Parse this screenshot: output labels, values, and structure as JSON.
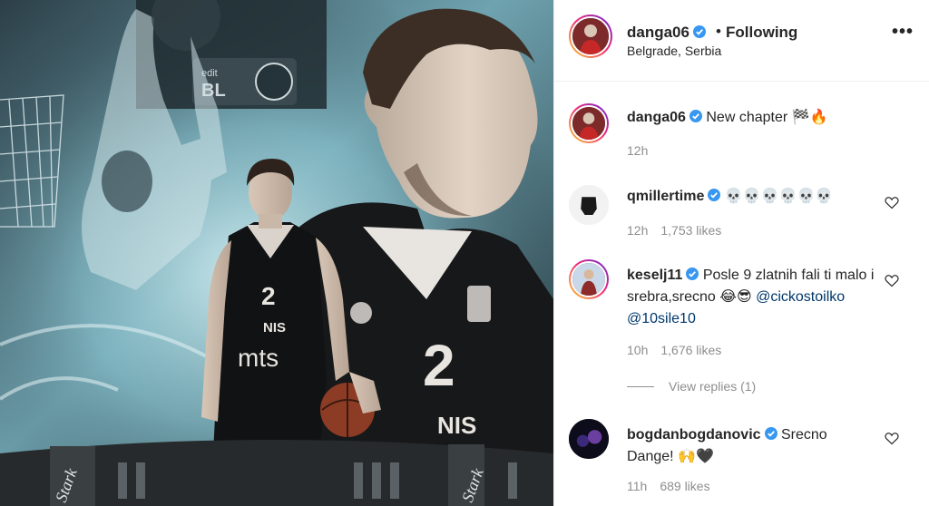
{
  "post": {
    "username": "danga06",
    "follow_status": "Following",
    "separator": "•",
    "location": "Belgrade, Serbia",
    "more_icon": "•••"
  },
  "image": {
    "jersey_number": "2",
    "sponsor_main": "mts",
    "sponsor_nis": "NIS",
    "scoreboard_text": "edit",
    "scoreboard_sub": "BL",
    "arena_text": "Stark"
  },
  "caption": {
    "username": "danga06",
    "text": "New chapter 🏁🔥",
    "time": "12h"
  },
  "comments": [
    {
      "username": "qmillertime",
      "text": "💀💀💀💀💀💀",
      "time": "12h",
      "likes": "1,753 likes"
    },
    {
      "username": "keselj11",
      "text": "Posle 9 zlatnih fali ti malo i srebra,srecno 😂😎",
      "mention1": "@cickostoilko",
      "mention2": "@10sile10",
      "time": "10h",
      "likes": "1,676 likes",
      "view_replies": "View replies (1)"
    },
    {
      "username": "bogdanbogdanovic",
      "text": "Srecno Dange! 🙌🖤",
      "time": "11h",
      "likes": "689 likes"
    }
  ],
  "colors": {
    "verified": "#3897f0",
    "muted_text": "#8e8e8e",
    "mention": "#00376b"
  }
}
